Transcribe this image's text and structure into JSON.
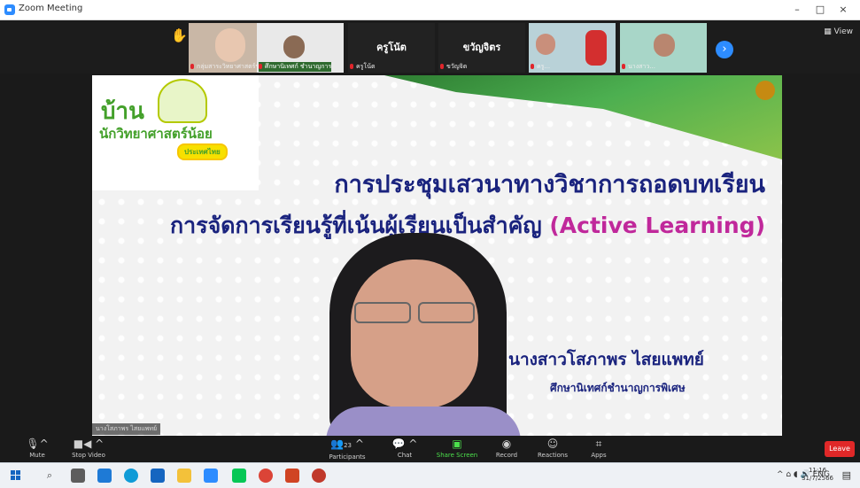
{
  "window": {
    "title": "Zoom Meeting",
    "minimize": "–",
    "maximize": "□",
    "close": "×",
    "view_label": "View"
  },
  "participants_strip": {
    "tiles": [
      {
        "name": "กลุ่มสาระวิทยาศาสตร์ฯ"
      },
      {
        "name": "ศึกษานิเทศก์ ชำนาญการ"
      },
      {
        "name": "ครูโน้ต",
        "display": "ครูโน้ต"
      },
      {
        "name": "ขวัญจิต",
        "display": "ขวัญจิตร"
      },
      {
        "name": "ครู..."
      },
      {
        "name": "นางสาว..."
      }
    ],
    "next_icon": "chevron-right-icon"
  },
  "slide": {
    "logo_title": "บ้าน",
    "logo_subtitle": "นักวิทยาศาสตร์น้อย",
    "logo_badge": "ประเทศไทย",
    "title_line1": "การประชุมเสวนาทางวิชาการถอดบทเรียน",
    "title_line2_th": "การจัดการเรียนรู้ที่เน้นผู้เรียนเป็นสำคัญ",
    "title_line2_en": "(Active Learning)",
    "speaker_name": "นางสาวโสภาพร ไสยแพทย์",
    "speaker_position": "ศึกษานิเทศก์ชำนาญการพิเศษ"
  },
  "video_name_label": "นางโสภาพร ไสยแพทย์",
  "controls": {
    "mute": "Mute",
    "stop_video": "Stop Video",
    "participants": "Participants",
    "participants_count": "23",
    "chat": "Chat",
    "share_screen": "Share Screen",
    "record": "Record",
    "reactions": "Reactions",
    "apps": "Apps",
    "leave": "Leave"
  },
  "taskbar": {
    "time": "11:16",
    "date": "31/7/2566",
    "tray": "^ ⌂ ◖ 🔊 ENG"
  },
  "colors": {
    "zoom_blue": "#2d8cff",
    "leave_red": "#e02828",
    "share_green": "#4ce04c",
    "slide_navy": "#1a237e",
    "slide_magenta": "#c0289b",
    "logo_green": "#43a02a"
  }
}
